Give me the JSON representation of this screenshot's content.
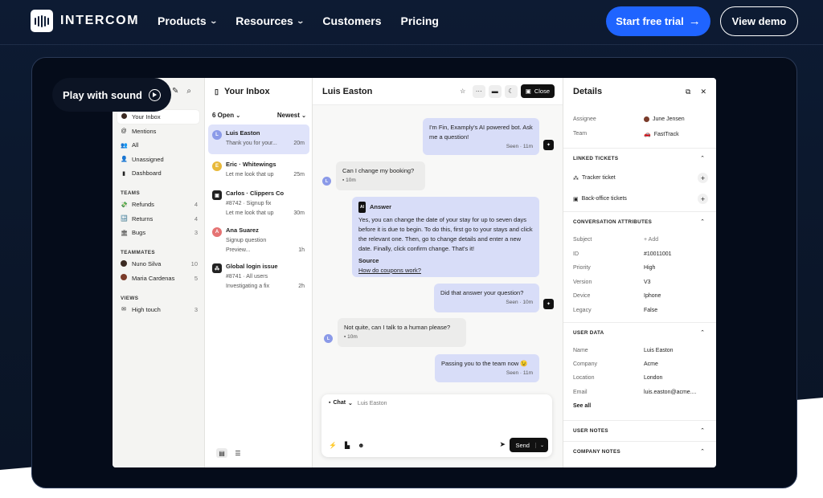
{
  "brand": {
    "name": "INTERCOM"
  },
  "nav": {
    "links": [
      {
        "label": "Products",
        "dropdown": true
      },
      {
        "label": "Resources",
        "dropdown": true
      },
      {
        "label": "Customers",
        "dropdown": false
      },
      {
        "label": "Pricing",
        "dropdown": false
      }
    ],
    "trial_label": "Start free trial",
    "demo_label": "View demo"
  },
  "sound": {
    "label": "Play with sound"
  },
  "sidebar": {
    "items": [
      {
        "label": "Your Inbox",
        "icon": "avatar-icon",
        "active": true
      },
      {
        "label": "Mentions",
        "icon": "at-icon"
      },
      {
        "label": "All",
        "icon": "people-icon"
      },
      {
        "label": "Unassigned",
        "icon": "user-icon"
      },
      {
        "label": "Dashboard",
        "icon": "chart-icon"
      }
    ],
    "teams_heading": "TEAMS",
    "teams": [
      {
        "label": "Refunds",
        "count": "4",
        "icon": "money-icon"
      },
      {
        "label": "Returns",
        "count": "4",
        "icon": "return-icon"
      },
      {
        "label": "Bugs",
        "count": "3",
        "icon": "bank-icon"
      }
    ],
    "teammates_heading": "TEAMMATES",
    "teammates": [
      {
        "label": "Nuno Silva",
        "count": "10",
        "color": "#3b2a22"
      },
      {
        "label": "Maria Cardenas",
        "count": "5",
        "color": "#7a3b2a"
      }
    ],
    "views_heading": "VIEWS",
    "views": [
      {
        "label": "High touch",
        "count": "3",
        "icon": "mail-icon"
      }
    ]
  },
  "inbox": {
    "title": "Your Inbox",
    "open_filter": "6 Open",
    "sort_filter": "Newest",
    "conversations": [
      {
        "initial": "L",
        "color": "#8b9ae8",
        "name": "Luis Easton",
        "line2": "Thank you for your...",
        "line3": "",
        "time": "20m",
        "active": true
      },
      {
        "initial": "E",
        "color": "#e8b93a",
        "name": "Eric · Whitewings",
        "line2": "Let me look that up",
        "line3": "",
        "time": "25m"
      },
      {
        "initial": "C",
        "color": "#222222",
        "name": "Carlos · Clippers Co",
        "line2": "#8742 · Signup fix",
        "line3": "Let me look that up",
        "time": "30m"
      },
      {
        "initial": "A",
        "color": "#e57373",
        "name": "Ana Suarez",
        "line2": "Signup question",
        "line3": "Preview...",
        "time": "1h"
      },
      {
        "initial": "G",
        "color": "#222222",
        "name": "Global login issue",
        "line2": "#8741 · All users",
        "line3": "Investigating a fix",
        "time": "2h"
      }
    ]
  },
  "chat": {
    "title": "Luis Easton",
    "close_label": "Close",
    "messages": {
      "m1": {
        "text": "I'm Fin, Examply's AI powered bot. Ask me a question!",
        "meta": "Seen · 11m"
      },
      "m2": {
        "text": "Can I change my booking?",
        "meta": "10m",
        "initial": "L"
      },
      "m3": {
        "heading": "Answer",
        "text": "Yes, you can change the date of your stay for up to seven days before it is due to begin. To do this, first go to your stays and click the relevant one. Then, go to change details and enter a new date. Finally, click confirm change. That's it!",
        "source_label": "Source",
        "source_link": "How do coupons work?"
      },
      "m4": {
        "text": "Did that answer your question?",
        "meta": "Seen · 10m"
      },
      "m5": {
        "text": "Not quite, can I talk to a human please?",
        "meta": "10m",
        "initial": "L"
      },
      "m6": {
        "text": "Passing you to the team now 😉",
        "meta": "Seen · 11m"
      }
    },
    "composer": {
      "mode": "Chat",
      "recipient": "Luis Easton",
      "send_label": "Send"
    }
  },
  "details": {
    "title": "Details",
    "assignee_label": "Assignee",
    "assignee_value": "June Jensen",
    "team_label": "Team",
    "team_value": "FastTrack",
    "linked_heading": "LINKED TICKETS",
    "tracker": "Tracker ticket",
    "backoffice": "Back-office tickets",
    "attributes_heading": "CONVERSATION ATTRIBUTES",
    "attributes": [
      {
        "k": "Subject",
        "v": "+ Add",
        "muted": true
      },
      {
        "k": "ID",
        "v": "#10011001"
      },
      {
        "k": "Priority",
        "v": "High"
      },
      {
        "k": "Version",
        "v": "V3"
      },
      {
        "k": "Device",
        "v": "Iphone"
      },
      {
        "k": "Legacy",
        "v": "False"
      }
    ],
    "userdata_heading": "USER DATA",
    "userdata": [
      {
        "k": "Name",
        "v": "Luis Easton"
      },
      {
        "k": "Company",
        "v": "Acme"
      },
      {
        "k": "Location",
        "v": "London"
      },
      {
        "k": "Email",
        "v": "luis.easton@acme...."
      }
    ],
    "see_all": "See all",
    "usernotes_heading": "USER NOTES",
    "companynotes_heading": "COMPANY NOTES"
  }
}
